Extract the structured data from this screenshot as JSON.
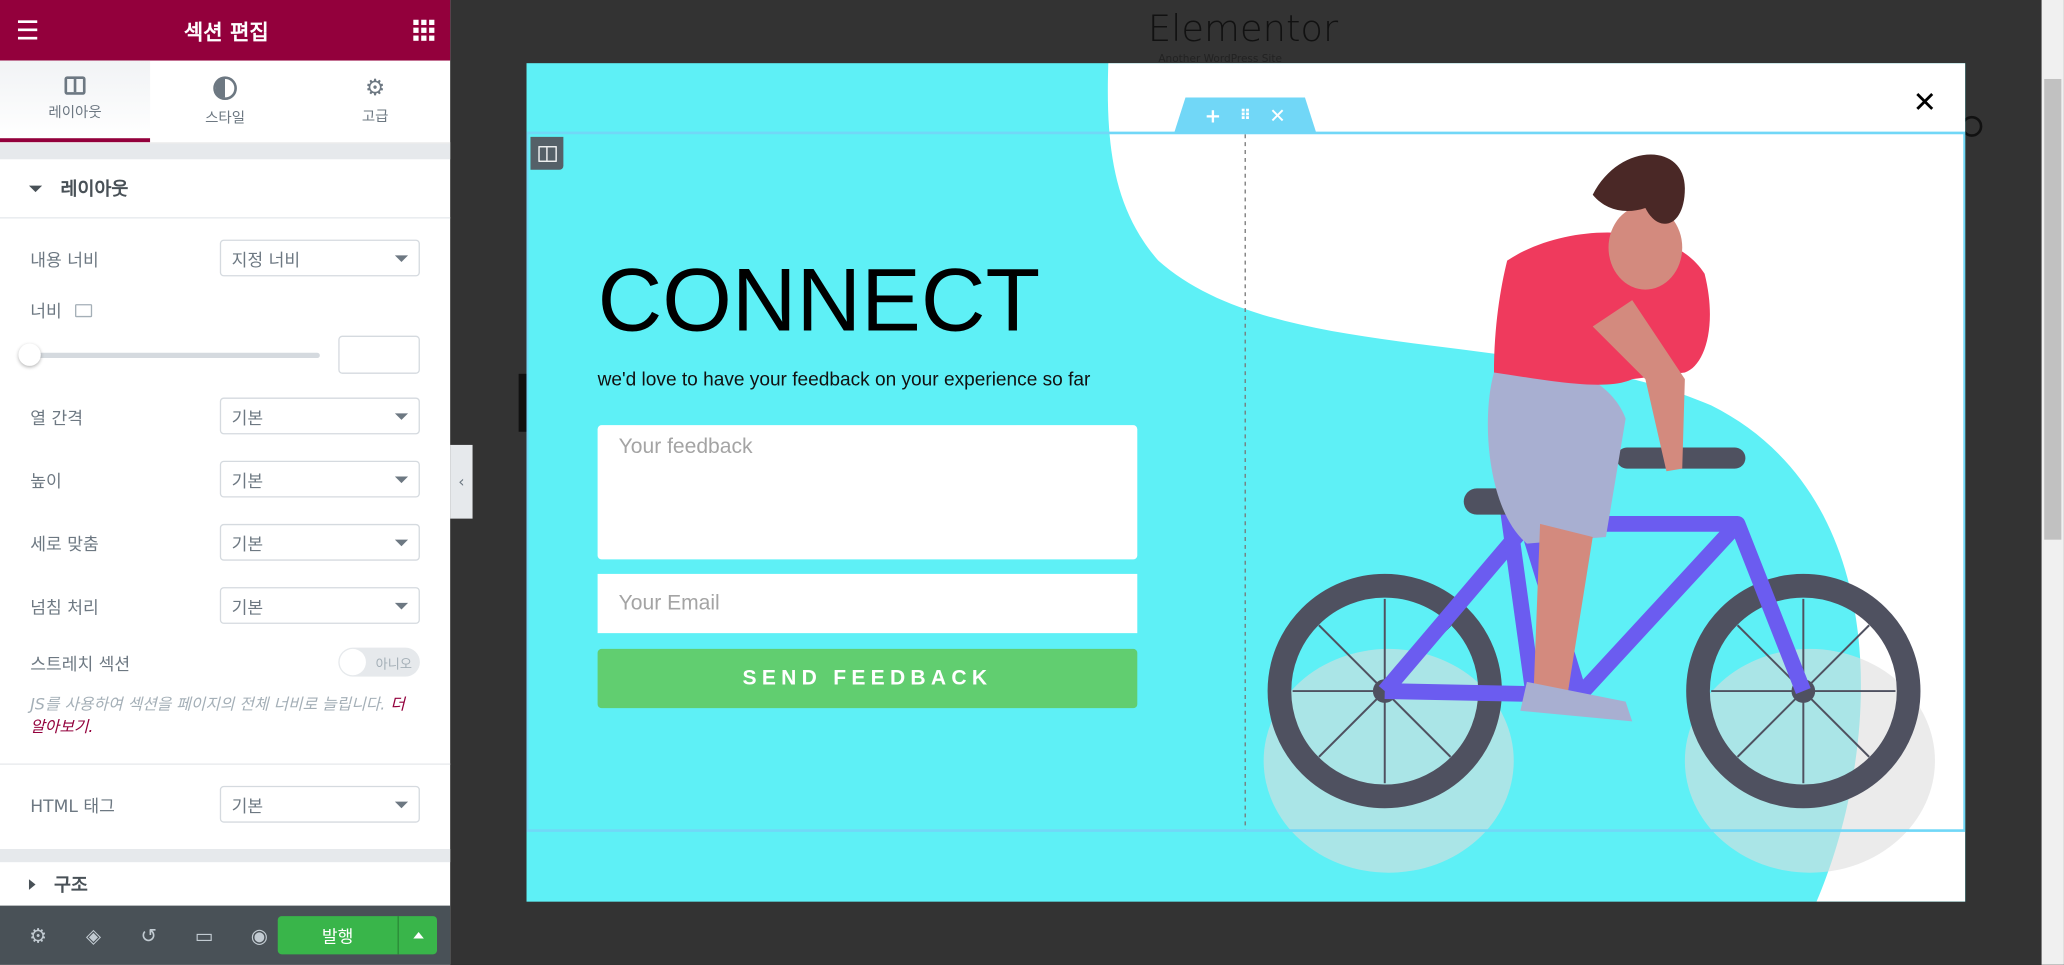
{
  "panel": {
    "title": "섹션 편집",
    "tabs": [
      {
        "label": "레이아웃",
        "icon": "columns-icon"
      },
      {
        "label": "스타일",
        "icon": "contrast-icon"
      },
      {
        "label": "고급",
        "icon": "gear-icon"
      }
    ],
    "section_title": "레이아웃",
    "fields": {
      "content_width": {
        "label": "내용 너비",
        "value": "지정 너비"
      },
      "width": {
        "label": "너비",
        "slider_value": 0,
        "input_value": ""
      },
      "column_gap": {
        "label": "열 간격",
        "value": "기본"
      },
      "height": {
        "label": "높이",
        "value": "기본"
      },
      "vertical_align": {
        "label": "세로 맞춤",
        "value": "기본"
      },
      "overflow": {
        "label": "넘침 처리",
        "value": "기본"
      },
      "stretch": {
        "label": "스트레치 섹션",
        "toggle": "아니오",
        "toggle_on": false
      },
      "help_text": "JS를 사용하여 섹션을 페이지의 전체 너비로 늘립니다.",
      "help_link": "더 알아보기.",
      "html_tag": {
        "label": "HTML 태그",
        "value": "기본"
      }
    },
    "structure_title": "구조",
    "publish_label": "발행"
  },
  "background_page": {
    "site_title": "Elementor",
    "tagline": "Another WordPress Site"
  },
  "modal": {
    "heading": "CONNECT",
    "subtitle": "we'd love to have your feedback on your experience so far",
    "feedback_placeholder": "Your feedback",
    "email_placeholder": "Your Email",
    "button_label": "SEND FEEDBACK",
    "colors": {
      "background": "#5ef0f6",
      "button": "#61ce70",
      "brand": "#93003c"
    }
  }
}
